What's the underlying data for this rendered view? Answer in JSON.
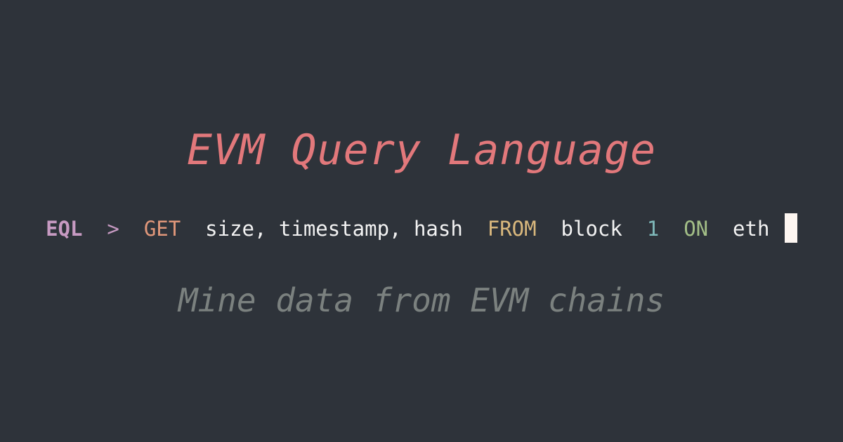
{
  "title": "EVM Query Language",
  "command": {
    "prompt_label": "EQL",
    "prompt_symbol": ">",
    "keyword_get": "GET",
    "fields": "size, timestamp, hash",
    "keyword_from": "FROM",
    "entity": "block",
    "id": "1",
    "keyword_on": "ON",
    "chain": "eth"
  },
  "tagline": "Mine data from EVM chains",
  "colors": {
    "background": "#2e333a",
    "title": "#e2787b",
    "prompt_label": "#c79ac2",
    "prompt_symbol": "#c79ac2",
    "keyword_get": "#e0977a",
    "plain_text": "#f2f2f2",
    "keyword_from": "#d9b87d",
    "number": "#7fb9ba",
    "keyword_on": "#a3bf87",
    "cursor": "#fdf6f1",
    "tagline": "#7b817f"
  }
}
